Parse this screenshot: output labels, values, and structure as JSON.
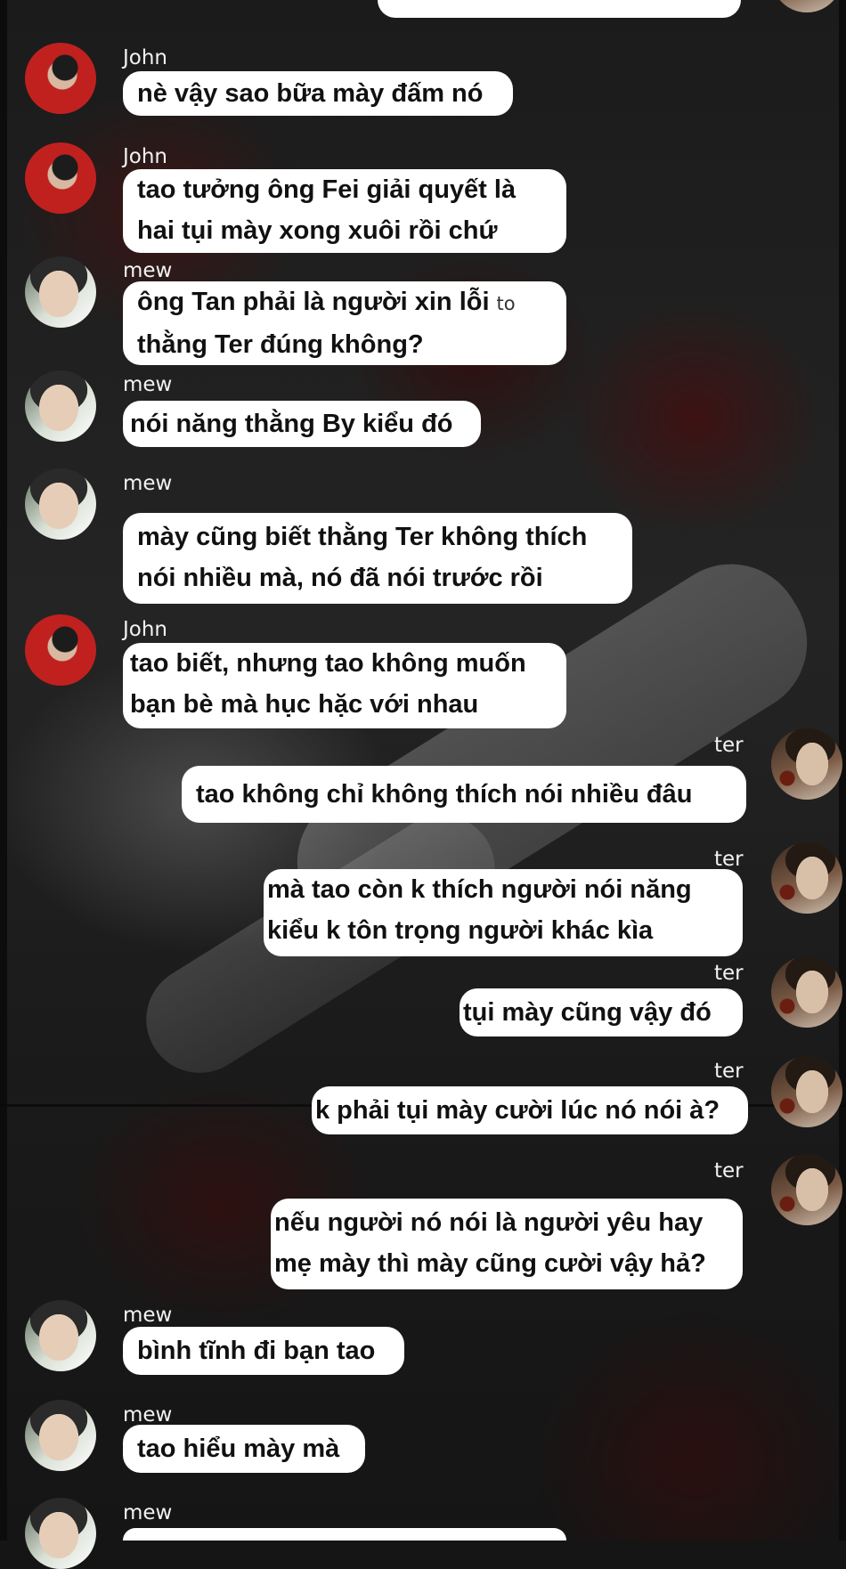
{
  "messages": [
    {
      "sender": "",
      "side": "right",
      "lines": [
        ""
      ]
    },
    {
      "sender": "John",
      "side": "left",
      "lines": [
        "nè vậy sao bữa mày đấm nó"
      ]
    },
    {
      "sender": "John",
      "side": "left",
      "lines": [
        "tao tưởng ông Fei giải quyết là",
        "hai tụi mày xong xuôi rồi chứ"
      ]
    },
    {
      "sender": "mew",
      "side": "left",
      "lines": [
        "ông Tan phải là người xin lỗi",
        "thằng Ter đúng không?"
      ],
      "inline_small": "to"
    },
    {
      "sender": "mew",
      "side": "left",
      "lines": [
        "nói năng thằng By kiểu đó"
      ]
    },
    {
      "sender": "mew",
      "side": "left",
      "lines": [
        "mày cũng biết thằng Ter không thích",
        "nói nhiều mà, nó đã nói trước rồi"
      ]
    },
    {
      "sender": "John",
      "side": "left",
      "lines": [
        "tao biết, nhưng tao không muốn",
        "bạn bè mà hục hặc với nhau"
      ]
    },
    {
      "sender": "ter",
      "side": "right",
      "lines": [
        "tao không chỉ không thích nói nhiều đâu"
      ]
    },
    {
      "sender": "ter",
      "side": "right",
      "lines": [
        "mà tao còn k thích người nói năng",
        "kiểu k tôn trọng người khác kìa"
      ]
    },
    {
      "sender": "ter",
      "side": "right",
      "lines": [
        "tụi mày cũng vậy đó"
      ]
    },
    {
      "sender": "ter",
      "side": "right",
      "lines": [
        "k phải tụi mày cười lúc nó nói à?"
      ]
    },
    {
      "sender": "ter",
      "side": "right",
      "lines": [
        "nếu người nó nói là người yêu hay",
        "mẹ mày thì mày cũng cười vậy hả?"
      ]
    },
    {
      "sender": "mew",
      "side": "left",
      "lines": [
        "bình tĩnh đi bạn tao"
      ]
    },
    {
      "sender": "mew",
      "side": "left",
      "lines": [
        "tao hiểu mày mà"
      ]
    },
    {
      "sender": "mew",
      "side": "left",
      "lines": [
        ""
      ]
    }
  ]
}
